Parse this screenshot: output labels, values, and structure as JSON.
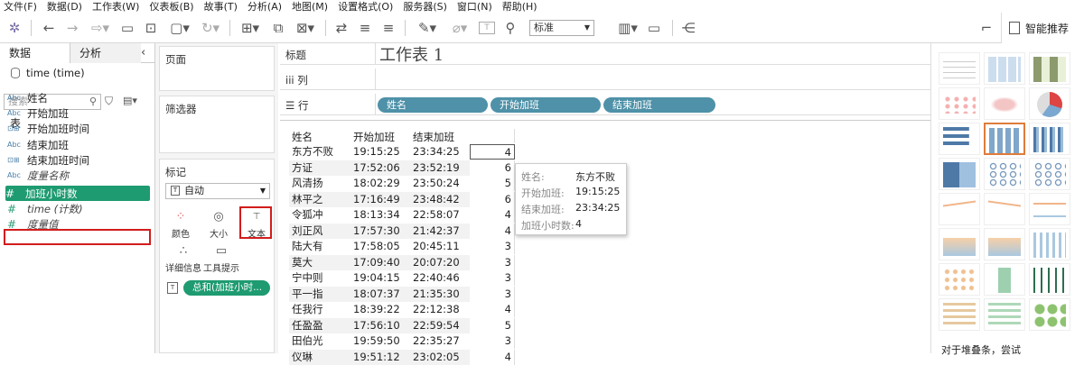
{
  "menu": [
    "文件(F)",
    "数据(D)",
    "工作表(W)",
    "仪表板(B)",
    "故事(T)",
    "分析(A)",
    "地图(M)",
    "设置格式(O)",
    "服务器(S)",
    "窗口(N)",
    "帮助(H)"
  ],
  "toolbar": {
    "format_select": "标准",
    "smart_recommend": "智能推荐"
  },
  "left": {
    "tabs": [
      "数据",
      "分析"
    ],
    "datasource": "time (time)",
    "search_placeholder": "搜索",
    "section": "表",
    "fields": [
      {
        "type": "Abc",
        "label": "姓名"
      },
      {
        "type": "Abc",
        "label": "开始加班"
      },
      {
        "type": "date",
        "label": "开始加班时间"
      },
      {
        "type": "Abc",
        "label": "结束加班"
      },
      {
        "type": "date",
        "label": "结束加班时间"
      },
      {
        "type": "Abc",
        "label": "度量名称"
      },
      {
        "type": "measure",
        "label": "加班小时数"
      },
      {
        "type": "measure",
        "label": "time (计数)"
      },
      {
        "type": "measure",
        "label": "度量值"
      }
    ]
  },
  "cards": {
    "pages": "页面",
    "filters": "筛选器",
    "marks": "标记",
    "mark_type": "自动",
    "mark_buttons": [
      "颜色",
      "大小",
      "文本",
      "详细信息",
      "工具提示"
    ],
    "text_pill": "总和(加班小时..."
  },
  "shelves": {
    "title_label": "标题",
    "title_value": "工作表 1",
    "columns_label": "列",
    "rows_label": "行",
    "row_pills": [
      "姓名",
      "开始加班",
      "结束加班"
    ]
  },
  "table": {
    "headers": [
      "姓名",
      "开始加班",
      "结束加班"
    ],
    "rows": [
      [
        "东方不败",
        "19:15:25",
        "23:34:25",
        "4"
      ],
      [
        "方证",
        "17:52:06",
        "23:52:19",
        "6"
      ],
      [
        "风清扬",
        "18:02:29",
        "23:50:24",
        "5"
      ],
      [
        "林平之",
        "17:16:49",
        "23:48:42",
        "6"
      ],
      [
        "令狐冲",
        "18:13:34",
        "22:58:07",
        "4"
      ],
      [
        "刘正风",
        "17:57:30",
        "21:42:37",
        "4"
      ],
      [
        "陆大有",
        "17:58:05",
        "20:45:11",
        "3"
      ],
      [
        "莫大",
        "17:09:40",
        "20:07:20",
        "3"
      ],
      [
        "宁中则",
        "19:04:15",
        "22:40:46",
        "3"
      ],
      [
        "平一指",
        "18:07:37",
        "21:35:30",
        "3"
      ],
      [
        "任我行",
        "18:39:22",
        "22:12:38",
        "4"
      ],
      [
        "任盈盈",
        "17:56:10",
        "22:59:54",
        "5"
      ],
      [
        "田伯光",
        "19:59:50",
        "22:35:27",
        "3"
      ],
      [
        "仪琳",
        "19:51:12",
        "23:02:05",
        "4"
      ]
    ]
  },
  "tooltip": {
    "rows": [
      {
        "k": "姓名:",
        "v": "东方不败"
      },
      {
        "k": "开始加班:",
        "v": "19:15:25"
      },
      {
        "k": "结束加班:",
        "v": "23:34:25"
      },
      {
        "k": "加班小时数:",
        "v": "4"
      }
    ]
  },
  "recommender": {
    "hint": "对于堆叠条，尝试"
  }
}
